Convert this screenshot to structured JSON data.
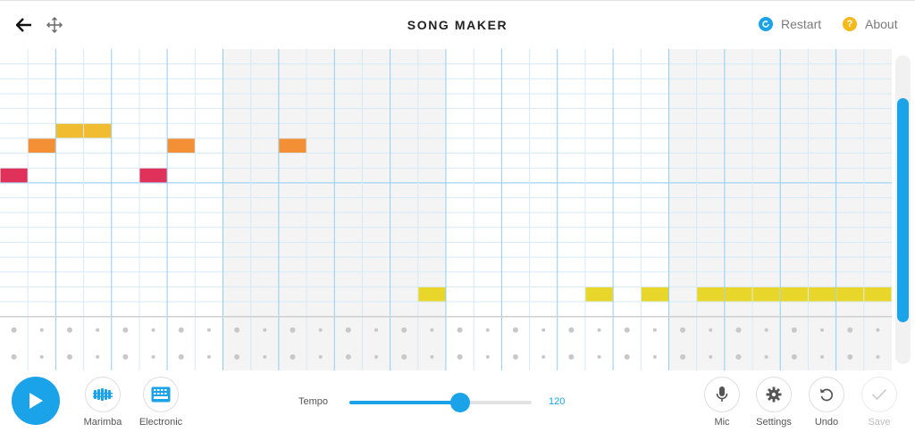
{
  "header": {
    "title": "SONG MAKER",
    "restart_label": "Restart",
    "about_label": "About",
    "icons": {
      "back": "arrow-left-icon",
      "move": "move-arrows-icon",
      "restart": "restart-icon",
      "about": "help-icon"
    }
  },
  "footer": {
    "instruments": [
      {
        "label": "Marimba",
        "icon": "marimba-icon"
      },
      {
        "label": "Electronic",
        "icon": "electronic-drum-icon"
      }
    ],
    "tempo_label": "Tempo",
    "tempo_value": "120",
    "tempo_fraction": 0.61,
    "actions": [
      {
        "label": "Mic",
        "icon": "mic-icon"
      },
      {
        "label": "Settings",
        "icon": "gear-icon"
      },
      {
        "label": "Undo",
        "icon": "undo-icon"
      },
      {
        "label": "Save",
        "icon": "check-icon",
        "disabled": true
      }
    ]
  },
  "grid": {
    "columns": 32,
    "melody_rows": 18,
    "percussion_rows": 2,
    "notes": [
      {
        "col": 0,
        "row": 8,
        "color": "#e0315a"
      },
      {
        "col": 1,
        "row": 6,
        "color": "#f39036"
      },
      {
        "col": 2,
        "row": 5,
        "color": "#f0bc30"
      },
      {
        "col": 3,
        "row": 5,
        "color": "#f0bc30"
      },
      {
        "col": 5,
        "row": 8,
        "color": "#e0315a"
      },
      {
        "col": 6,
        "row": 6,
        "color": "#f39036"
      },
      {
        "col": 10,
        "row": 6,
        "color": "#f39036"
      },
      {
        "col": 15,
        "row": 16,
        "color": "#e8d72a"
      },
      {
        "col": 21,
        "row": 16,
        "color": "#e8d72a"
      },
      {
        "col": 23,
        "row": 16,
        "color": "#e8d72a"
      },
      {
        "col": 25,
        "row": 16,
        "color": "#e8d72a"
      },
      {
        "col": 26,
        "row": 16,
        "color": "#e8d72a"
      },
      {
        "col": 27,
        "row": 16,
        "color": "#e8d72a"
      },
      {
        "col": 28,
        "row": 16,
        "color": "#e8d72a"
      },
      {
        "col": 29,
        "row": 16,
        "color": "#e8d72a"
      },
      {
        "col": 30,
        "row": 16,
        "color": "#e8d72a"
      },
      {
        "col": 31,
        "row": 16,
        "color": "#e8d72a"
      }
    ]
  },
  "colors": {
    "accent": "#1aa3e8",
    "restart": "#1aa3e8",
    "about": "#f6b91c"
  }
}
